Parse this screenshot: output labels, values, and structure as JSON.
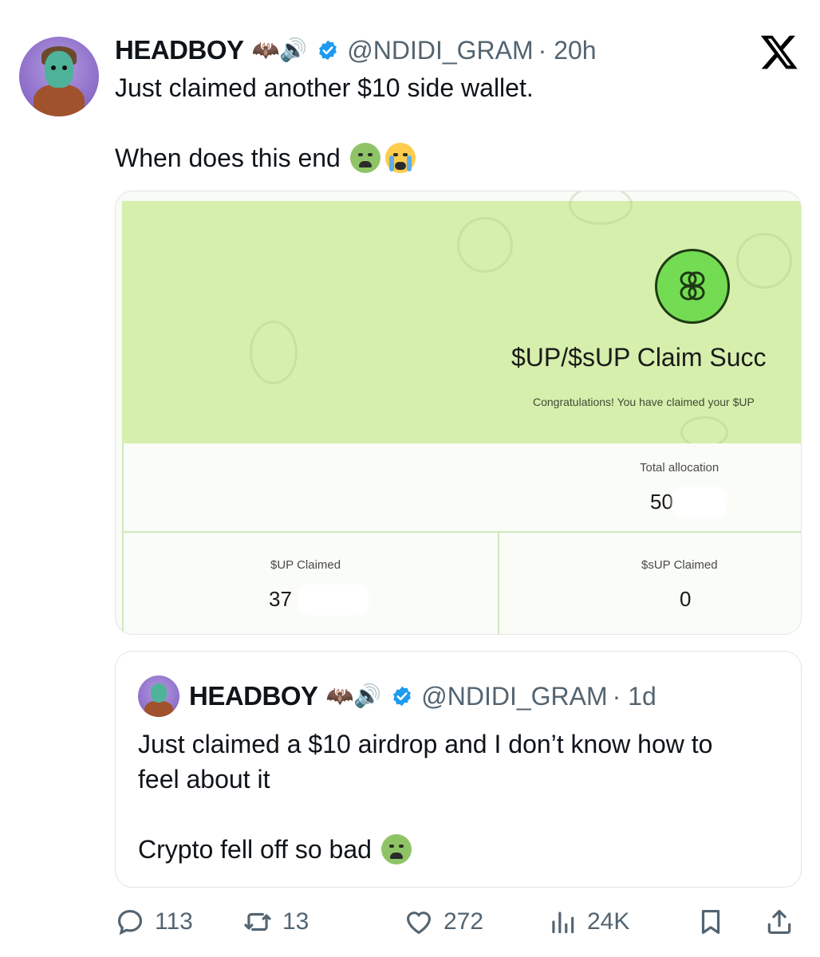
{
  "post": {
    "author_name": "HEADBOY",
    "author_emoji": "🦇🔊",
    "handle": "@NDIDI_GRAM",
    "time": "· 20h",
    "text_line1": "Just claimed another $10 side wallet.",
    "text_line2": "When does this end",
    "text_line2_emoji": [
      "nauseated-face",
      "loudly-crying-face"
    ]
  },
  "brand": {
    "icon": "x-logo"
  },
  "media": {
    "claim_title": "$UP/$sUP Claim Succ",
    "claim_subtitle": "Congratulations! You have claimed your $UP",
    "total_allocation_label": "Total allocation",
    "total_allocation_value": "50",
    "up_claimed_label": "$UP Claimed",
    "up_claimed_value": "37",
    "sup_claimed_label": "$sUP Claimed",
    "sup_claimed_value": "0",
    "colors": {
      "banner": "#d6efad",
      "logo": "#74dc52"
    }
  },
  "quote": {
    "author_name": "HEADBOY",
    "author_emoji": "🦇🔊",
    "handle": "@NDIDI_GRAM",
    "time": "· 1d",
    "text_line1": "Just claimed a $10 airdrop and I don’t know how to",
    "text_line2": "feel about it",
    "text_line3": "Crypto fell off so bad",
    "text_line3_emoji": [
      "nauseated-face"
    ]
  },
  "actions": {
    "replies": "113",
    "reposts": "13",
    "likes": "272",
    "views": "24K"
  },
  "colors": {
    "verified": "#1d9bf0",
    "muted_text": "#536471"
  }
}
